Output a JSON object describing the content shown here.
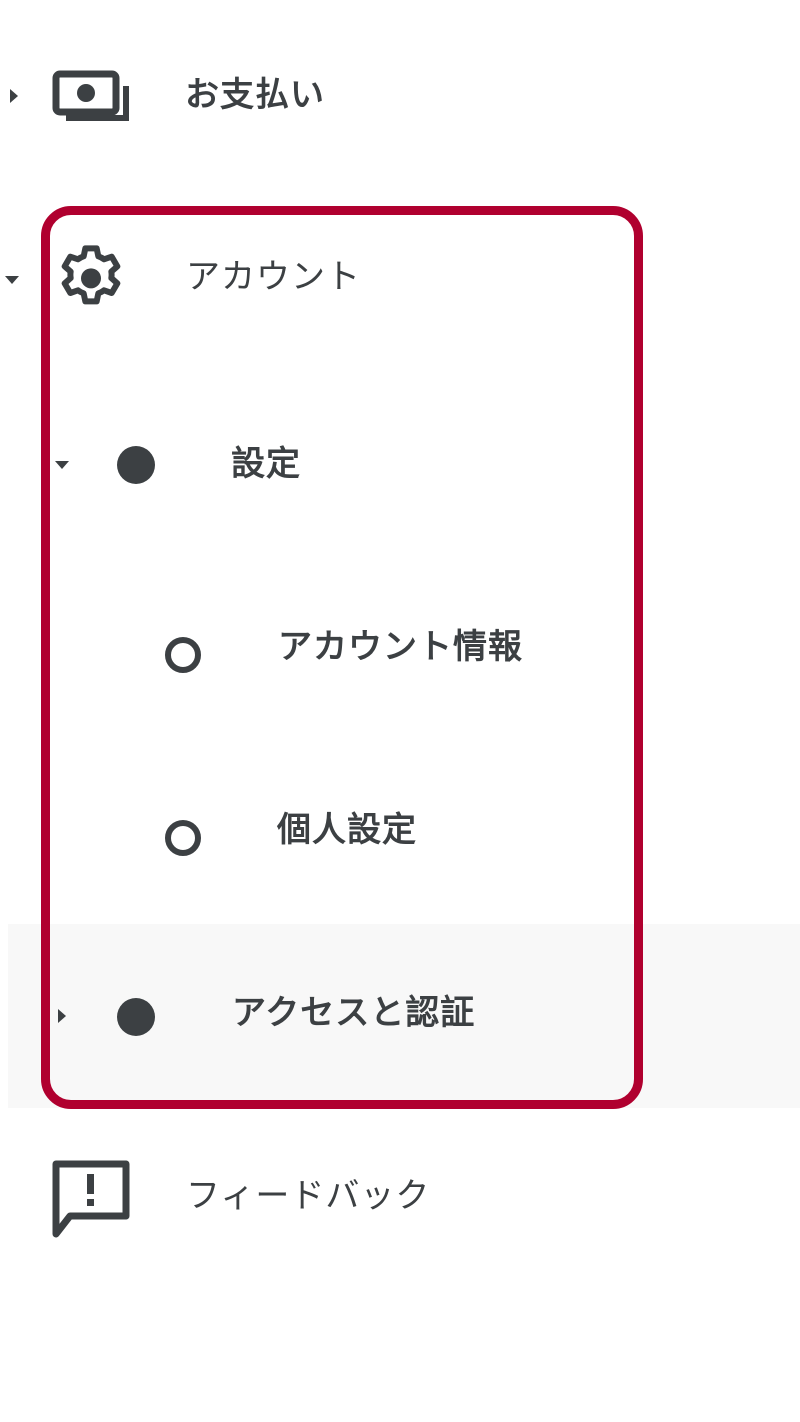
{
  "nav": {
    "payments": {
      "label": "お支払い",
      "icon": "payments-icon",
      "expanded": false
    },
    "account": {
      "label": "アカウント",
      "icon": "gear-icon",
      "expanded": true,
      "children": {
        "settings": {
          "label": "設定",
          "expanded": true,
          "children": [
            {
              "label": "アカウント情報"
            },
            {
              "label": "個人設定"
            }
          ]
        },
        "access": {
          "label": "アクセスと認証",
          "expanded": false
        }
      }
    },
    "feedback": {
      "label": "フィードバック",
      "icon": "feedback-icon"
    }
  },
  "colors": {
    "text": "#3c4043",
    "highlight": "#b0002f",
    "hover_band": "#f8f8f8"
  }
}
